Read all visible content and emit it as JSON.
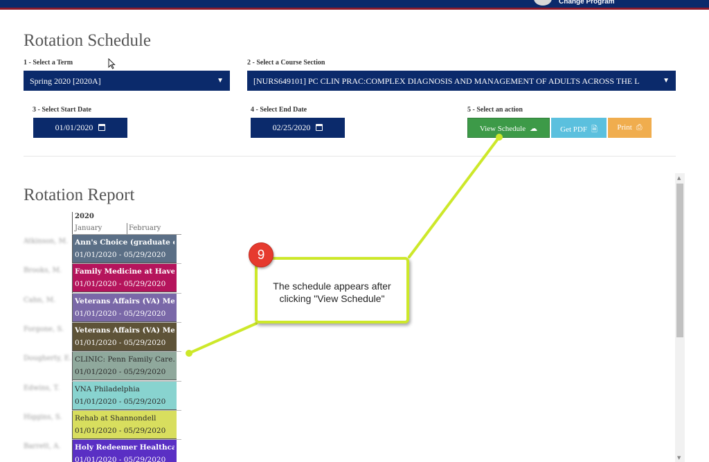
{
  "header": {
    "change_program_label": "Change Program"
  },
  "page": {
    "title": "Rotation Schedule",
    "report_title": "Rotation Report"
  },
  "filters": {
    "term": {
      "label": "1 - Select a Term",
      "value": "Spring 2020 [2020A]"
    },
    "course": {
      "label": "2 - Select a Course Section",
      "value": "[NURS649101] PC CLIN PRAC:COMPLEX DIAGNOSIS AND MANAGEMENT OF ADULTS ACROSS THE L"
    },
    "start_date": {
      "label": "3 - Select Start Date",
      "value": "01/01/2020"
    },
    "end_date": {
      "label": "4 - Select End Date",
      "value": "02/25/2020"
    },
    "action": {
      "label": "5 - Select an action"
    }
  },
  "actions": {
    "view_schedule": {
      "label": "View Schedule",
      "color": "#3d9a48"
    },
    "get_pdf": {
      "label": "Get PDF",
      "color": "#5bc0de"
    },
    "print": {
      "label": "Print",
      "color": "#f0ad4e"
    }
  },
  "timeline": {
    "year": "2020",
    "months": [
      "January",
      "February"
    ]
  },
  "rotations": [
    {
      "student": "Atkinson, M.",
      "site": "Ann's Choice (graduate only)",
      "dates": "01/01/2020 - 05/29/2020",
      "color": "#5b6f86",
      "text_color": "#ffffff"
    },
    {
      "student": "Brooks, M.",
      "site": "Family Medicine at Havert…",
      "dates": "01/01/2020 - 05/29/2020",
      "color": "#b5145c",
      "text_color": "#ffffff"
    },
    {
      "student": "Cahn, M.",
      "site": "Veterans Affairs (VA) Medi…",
      "dates": "01/01/2020 - 05/29/2020",
      "color": "#7a68a8",
      "text_color": "#ffffff"
    },
    {
      "student": "Forgone, S.",
      "site": "Veterans Affairs (VA) Medi…",
      "dates": "01/01/2020 - 05/29/2020",
      "color": "#5e5338",
      "text_color": "#ffffff"
    },
    {
      "student": "Dougherty, E.",
      "site": "CLINIC: Penn Family Care…",
      "dates": "01/01/2020 - 05/29/2020",
      "color": "#8fa89c",
      "text_color": "#2b2b2b"
    },
    {
      "student": "Edwins, T.",
      "site": "VNA Philadelphia",
      "dates": "01/01/2020 - 05/29/2020",
      "color": "#88d3cf",
      "text_color": "#2b2b2b"
    },
    {
      "student": "Higgins, S.",
      "site": "Rehab at Shannondell",
      "dates": "01/01/2020 - 05/29/2020",
      "color": "#d8de5e",
      "text_color": "#2b2b2b"
    },
    {
      "student": "Barrett, A.",
      "site": "Holy Redeemer Healthcare …",
      "dates": "01/01/2020 - 05/29/2020",
      "color": "#5a2fc4",
      "text_color": "#ffffff"
    }
  ],
  "annotation": {
    "step_number": "9",
    "line1": "The schedule appears after",
    "line2": "clicking \"View Schedule\"",
    "color": "#cde82a"
  }
}
